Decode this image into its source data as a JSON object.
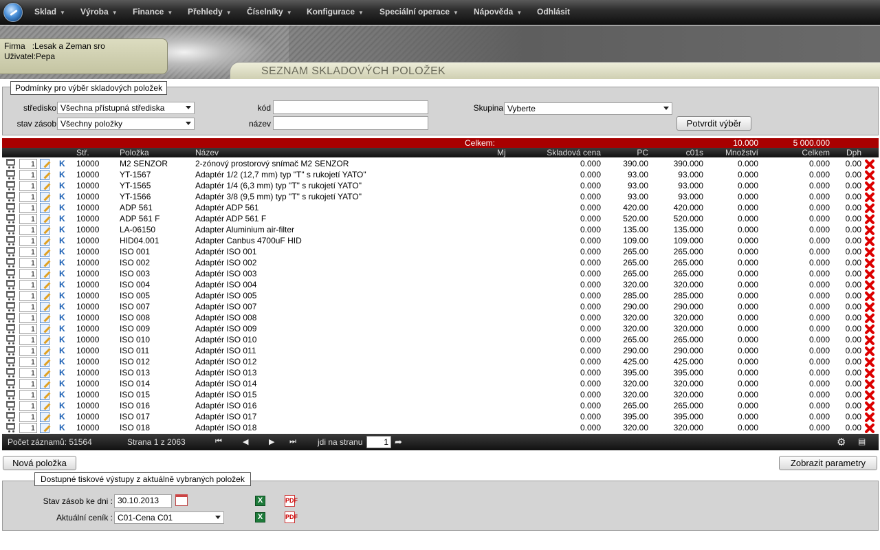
{
  "menu": {
    "items": [
      {
        "label": "Sklad",
        "caret": "▼"
      },
      {
        "label": "Výroba",
        "caret": "▼"
      },
      {
        "label": "Finance",
        "caret": "▼"
      },
      {
        "label": "Přehledy",
        "caret": "▼"
      },
      {
        "label": "Číselníky",
        "caret": "▼"
      },
      {
        "label": "Konfigurace",
        "caret": "▼"
      },
      {
        "label": "Speciální operace",
        "caret": "▼"
      },
      {
        "label": "Nápověda",
        "caret": "▼"
      },
      {
        "label": "Odhlásit",
        "caret": ""
      }
    ]
  },
  "header": {
    "firm_label": "Firma",
    "firm_value": ":Lesak a Zeman sro",
    "user_label": "Uživatel",
    "user_value": ":Pepa",
    "page_title": "SEZNAM SKLADOVÝCH POLOŽEK"
  },
  "filter": {
    "legend": "Podmínky pro výběr skladových položek",
    "stredisko_label": "středisko",
    "stredisko_value": "Všechna přístupná střediska",
    "stav_label": "stav zásob",
    "stav_value": "Všechny položky",
    "kod_label": "kód",
    "kod_value": "",
    "nazev_label": "název",
    "nazev_value": "",
    "skupina_label": "Skupina",
    "skupina_value": "Vyberte",
    "confirm_button": "Potvrdit výběr"
  },
  "table": {
    "totals": {
      "label": "Celkem:",
      "mnozstvi": "10.000",
      "celkem": "5 000.000"
    },
    "columns": {
      "str": "Stř.",
      "polozka": "Položka",
      "nazev": "Název",
      "mj": "Mj",
      "skladova_cena": "Skladová cena",
      "pc": "PC",
      "c01s": "c01s",
      "mnozstvi": "Množství",
      "celkem": "Celkem",
      "dph": "Dph"
    },
    "k_label": "K",
    "rows": [
      {
        "qty": "1",
        "str": "10000",
        "polozka": "M2 SENZOR",
        "nazev": "2-zónový prostorový snímač M2 SENZOR",
        "mj": "",
        "sc": "0.000",
        "pc": "390.00",
        "c01s": "390.000",
        "mn": "0.000",
        "cel": "0.000",
        "dph": "0.00"
      },
      {
        "qty": "1",
        "str": "10000",
        "polozka": "YT-1567",
        "nazev": "Adaptér 1/2 (12,7 mm) typ \"T\" s rukojetí YATO\"",
        "mj": "",
        "sc": "0.000",
        "pc": "93.00",
        "c01s": "93.000",
        "mn": "0.000",
        "cel": "0.000",
        "dph": "0.00"
      },
      {
        "qty": "1",
        "str": "10000",
        "polozka": "YT-1565",
        "nazev": "Adaptér 1/4 (6,3 mm) typ \"T\" s rukojetí YATO\"",
        "mj": "",
        "sc": "0.000",
        "pc": "93.00",
        "c01s": "93.000",
        "mn": "0.000",
        "cel": "0.000",
        "dph": "0.00"
      },
      {
        "qty": "1",
        "str": "10000",
        "polozka": "YT-1566",
        "nazev": "Adaptér 3/8 (9,5 mm) typ \"T\" s rukojetí YATO\"",
        "mj": "",
        "sc": "0.000",
        "pc": "93.00",
        "c01s": "93.000",
        "mn": "0.000",
        "cel": "0.000",
        "dph": "0.00"
      },
      {
        "qty": "1",
        "str": "10000",
        "polozka": "ADP 561",
        "nazev": "Adaptér ADP 561",
        "mj": "",
        "sc": "0.000",
        "pc": "420.00",
        "c01s": "420.000",
        "mn": "0.000",
        "cel": "0.000",
        "dph": "0.00"
      },
      {
        "qty": "1",
        "str": "10000",
        "polozka": "ADP 561 F",
        "nazev": "Adaptér ADP 561 F",
        "mj": "",
        "sc": "0.000",
        "pc": "520.00",
        "c01s": "520.000",
        "mn": "0.000",
        "cel": "0.000",
        "dph": "0.00"
      },
      {
        "qty": "1",
        "str": "10000",
        "polozka": "LA-06150",
        "nazev": "Adapter Aluminium air-filter",
        "mj": "",
        "sc": "0.000",
        "pc": "135.00",
        "c01s": "135.000",
        "mn": "0.000",
        "cel": "0.000",
        "dph": "0.00"
      },
      {
        "qty": "1",
        "str": "10000",
        "polozka": "HID04.001",
        "nazev": "Adapter Canbus 4700uF HID",
        "mj": "",
        "sc": "0.000",
        "pc": "109.00",
        "c01s": "109.000",
        "mn": "0.000",
        "cel": "0.000",
        "dph": "0.00"
      },
      {
        "qty": "1",
        "str": "10000",
        "polozka": "ISO 001",
        "nazev": "Adaptér ISO 001",
        "mj": "",
        "sc": "0.000",
        "pc": "265.00",
        "c01s": "265.000",
        "mn": "0.000",
        "cel": "0.000",
        "dph": "0.00"
      },
      {
        "qty": "1",
        "str": "10000",
        "polozka": "ISO 002",
        "nazev": "Adaptér ISO 002",
        "mj": "",
        "sc": "0.000",
        "pc": "265.00",
        "c01s": "265.000",
        "mn": "0.000",
        "cel": "0.000",
        "dph": "0.00"
      },
      {
        "qty": "1",
        "str": "10000",
        "polozka": "ISO 003",
        "nazev": "Adaptér ISO 003",
        "mj": "",
        "sc": "0.000",
        "pc": "265.00",
        "c01s": "265.000",
        "mn": "0.000",
        "cel": "0.000",
        "dph": "0.00"
      },
      {
        "qty": "1",
        "str": "10000",
        "polozka": "ISO 004",
        "nazev": "Adaptér ISO 004",
        "mj": "",
        "sc": "0.000",
        "pc": "320.00",
        "c01s": "320.000",
        "mn": "0.000",
        "cel": "0.000",
        "dph": "0.00"
      },
      {
        "qty": "1",
        "str": "10000",
        "polozka": "ISO 005",
        "nazev": "Adaptér ISO 005",
        "mj": "",
        "sc": "0.000",
        "pc": "285.00",
        "c01s": "285.000",
        "mn": "0.000",
        "cel": "0.000",
        "dph": "0.00"
      },
      {
        "qty": "1",
        "str": "10000",
        "polozka": "ISO 007",
        "nazev": "Adaptér ISO 007",
        "mj": "",
        "sc": "0.000",
        "pc": "290.00",
        "c01s": "290.000",
        "mn": "0.000",
        "cel": "0.000",
        "dph": "0.00"
      },
      {
        "qty": "1",
        "str": "10000",
        "polozka": "ISO 008",
        "nazev": "Adaptér ISO 008",
        "mj": "",
        "sc": "0.000",
        "pc": "320.00",
        "c01s": "320.000",
        "mn": "0.000",
        "cel": "0.000",
        "dph": "0.00"
      },
      {
        "qty": "1",
        "str": "10000",
        "polozka": "ISO 009",
        "nazev": "Adaptér ISO 009",
        "mj": "",
        "sc": "0.000",
        "pc": "320.00",
        "c01s": "320.000",
        "mn": "0.000",
        "cel": "0.000",
        "dph": "0.00"
      },
      {
        "qty": "1",
        "str": "10000",
        "polozka": "ISO 010",
        "nazev": "Adaptér ISO 010",
        "mj": "",
        "sc": "0.000",
        "pc": "265.00",
        "c01s": "265.000",
        "mn": "0.000",
        "cel": "0.000",
        "dph": "0.00"
      },
      {
        "qty": "1",
        "str": "10000",
        "polozka": "ISO 011",
        "nazev": "Adaptér ISO 011",
        "mj": "",
        "sc": "0.000",
        "pc": "290.00",
        "c01s": "290.000",
        "mn": "0.000",
        "cel": "0.000",
        "dph": "0.00"
      },
      {
        "qty": "1",
        "str": "10000",
        "polozka": "ISO 012",
        "nazev": "Adaptér ISO 012",
        "mj": "",
        "sc": "0.000",
        "pc": "425.00",
        "c01s": "425.000",
        "mn": "0.000",
        "cel": "0.000",
        "dph": "0.00"
      },
      {
        "qty": "1",
        "str": "10000",
        "polozka": "ISO 013",
        "nazev": "Adaptér ISO 013",
        "mj": "",
        "sc": "0.000",
        "pc": "395.00",
        "c01s": "395.000",
        "mn": "0.000",
        "cel": "0.000",
        "dph": "0.00"
      },
      {
        "qty": "1",
        "str": "10000",
        "polozka": "ISO 014",
        "nazev": "Adaptér ISO 014",
        "mj": "",
        "sc": "0.000",
        "pc": "320.00",
        "c01s": "320.000",
        "mn": "0.000",
        "cel": "0.000",
        "dph": "0.00"
      },
      {
        "qty": "1",
        "str": "10000",
        "polozka": "ISO 015",
        "nazev": "Adaptér ISO 015",
        "mj": "",
        "sc": "0.000",
        "pc": "320.00",
        "c01s": "320.000",
        "mn": "0.000",
        "cel": "0.000",
        "dph": "0.00"
      },
      {
        "qty": "1",
        "str": "10000",
        "polozka": "ISO 016",
        "nazev": "Adaptér ISO 016",
        "mj": "",
        "sc": "0.000",
        "pc": "265.00",
        "c01s": "265.000",
        "mn": "0.000",
        "cel": "0.000",
        "dph": "0.00"
      },
      {
        "qty": "1",
        "str": "10000",
        "polozka": "ISO 017",
        "nazev": "Adaptér ISO 017",
        "mj": "",
        "sc": "0.000",
        "pc": "395.00",
        "c01s": "395.000",
        "mn": "0.000",
        "cel": "0.000",
        "dph": "0.00"
      },
      {
        "qty": "1",
        "str": "10000",
        "polozka": "ISO 018",
        "nazev": "Adaptér ISO 018",
        "mj": "",
        "sc": "0.000",
        "pc": "320.00",
        "c01s": "320.000",
        "mn": "0.000",
        "cel": "0.000",
        "dph": "0.00"
      }
    ]
  },
  "pager": {
    "record_count": "Počet záznamů: 51564",
    "page_info": "Strana 1 z 2063",
    "first": "⏮",
    "prev": "◀",
    "next": "▶",
    "last": "⏭",
    "goto_label": "jdi na stranu",
    "goto_value": "1",
    "goto_arrow": "➦"
  },
  "actions": {
    "new_item": "Nová položka",
    "show_params": "Zobrazit parametry"
  },
  "print": {
    "legend": "Dostupné tiskové výstupy z aktuálně vybraných položek",
    "stav_label": "Stav zásob ke dni :",
    "stav_date": "30.10.2013",
    "cenik_label": "Aktuální ceník :",
    "cenik_value": "C01-Cena C01",
    "xls": "X",
    "pdf": "PDF"
  },
  "icons": [
    "logo-icon",
    "cart-icon",
    "edit-icon",
    "delete-icon",
    "settings-icon",
    "export-icon",
    "calendar-icon",
    "excel-icon",
    "pdf-icon"
  ],
  "colors": {
    "totals_bar": "#a80000",
    "k_link": "#1a5fb4",
    "delete": "#dd0000"
  }
}
